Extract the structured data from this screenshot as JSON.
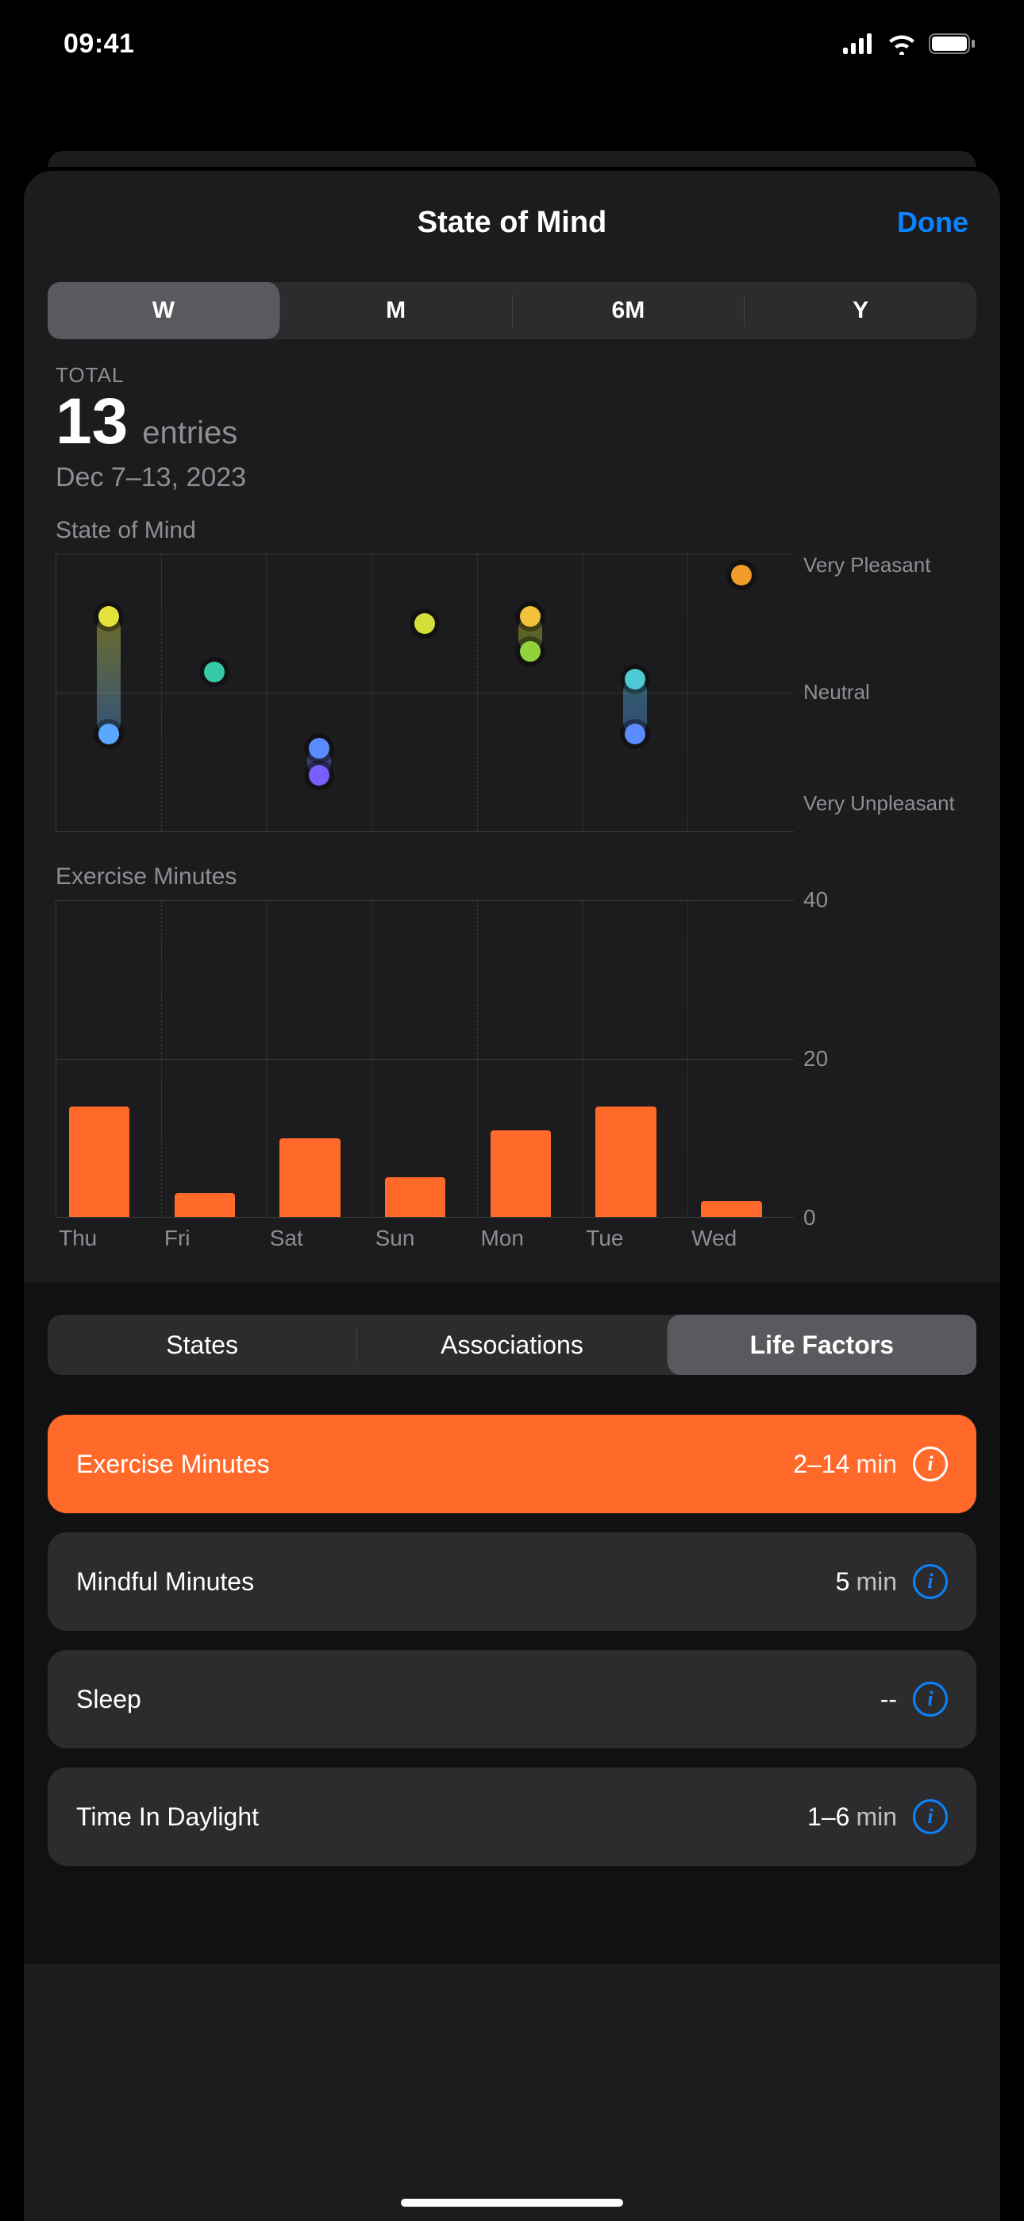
{
  "status": {
    "time": "09:41"
  },
  "header": {
    "title": "State of Mind",
    "done": "Done"
  },
  "range": {
    "items": [
      "W",
      "M",
      "6M",
      "Y"
    ],
    "selected_index": 0
  },
  "summary": {
    "total_label": "TOTAL",
    "value": "13",
    "unit": "entries",
    "date_range": "Dec 7–13, 2023"
  },
  "chart_data": [
    {
      "type": "scatter",
      "title": "State of Mind",
      "categories": [
        "Thu",
        "Fri",
        "Sat",
        "Sun",
        "Mon",
        "Tue",
        "Wed"
      ],
      "y_scale": {
        "min": -1,
        "max": 1
      },
      "y_tick_labels": [
        "Very Pleasant",
        "Neutral",
        "Very Unpleasant"
      ],
      "notes": "y is -1 (Very Unpleasant) to 1 (Very Pleasant). Multiple entries per day shown as dots; vertical range shown as a pill.",
      "series": [
        {
          "day": "Thu",
          "values": [
            0.55,
            -0.3
          ],
          "colors": [
            "#e4e23a",
            "#5aa7ff"
          ]
        },
        {
          "day": "Fri",
          "values": [
            0.15
          ],
          "colors": [
            "#36c9a7"
          ]
        },
        {
          "day": "Sat",
          "values": [
            -0.4,
            -0.6
          ],
          "colors": [
            "#5a8bff",
            "#7a5cff"
          ]
        },
        {
          "day": "Sun",
          "values": [
            0.5
          ],
          "colors": [
            "#d6df3a"
          ]
        },
        {
          "day": "Mon",
          "values": [
            0.55,
            0.3
          ],
          "colors": [
            "#f2c23a",
            "#8fd23a"
          ]
        },
        {
          "day": "Tue",
          "values": [
            0.1,
            -0.3
          ],
          "colors": [
            "#4ec9d6",
            "#5a8bff"
          ]
        },
        {
          "day": "Wed",
          "values": [
            0.85
          ],
          "colors": [
            "#f29b2b"
          ]
        }
      ]
    },
    {
      "type": "bar",
      "title": "Exercise Minutes",
      "categories": [
        "Thu",
        "Fri",
        "Sat",
        "Sun",
        "Mon",
        "Tue",
        "Wed"
      ],
      "values": [
        14,
        3,
        10,
        5,
        11,
        14,
        2
      ],
      "ylim": [
        0,
        40
      ],
      "y_ticks": [
        0,
        20,
        40
      ],
      "bar_color": "#ff6a2b"
    }
  ],
  "tabs": {
    "items": [
      "States",
      "Associations",
      "Life Factors"
    ],
    "selected_index": 2
  },
  "factors": [
    {
      "label": "Exercise Minutes",
      "value": "2–14",
      "unit": "min",
      "selected": true
    },
    {
      "label": "Mindful Minutes",
      "value": "5",
      "unit": "min",
      "selected": false
    },
    {
      "label": "Sleep",
      "value": "--",
      "unit": "",
      "selected": false
    },
    {
      "label": "Time In Daylight",
      "value": "1–6",
      "unit": "min",
      "selected": false
    }
  ]
}
